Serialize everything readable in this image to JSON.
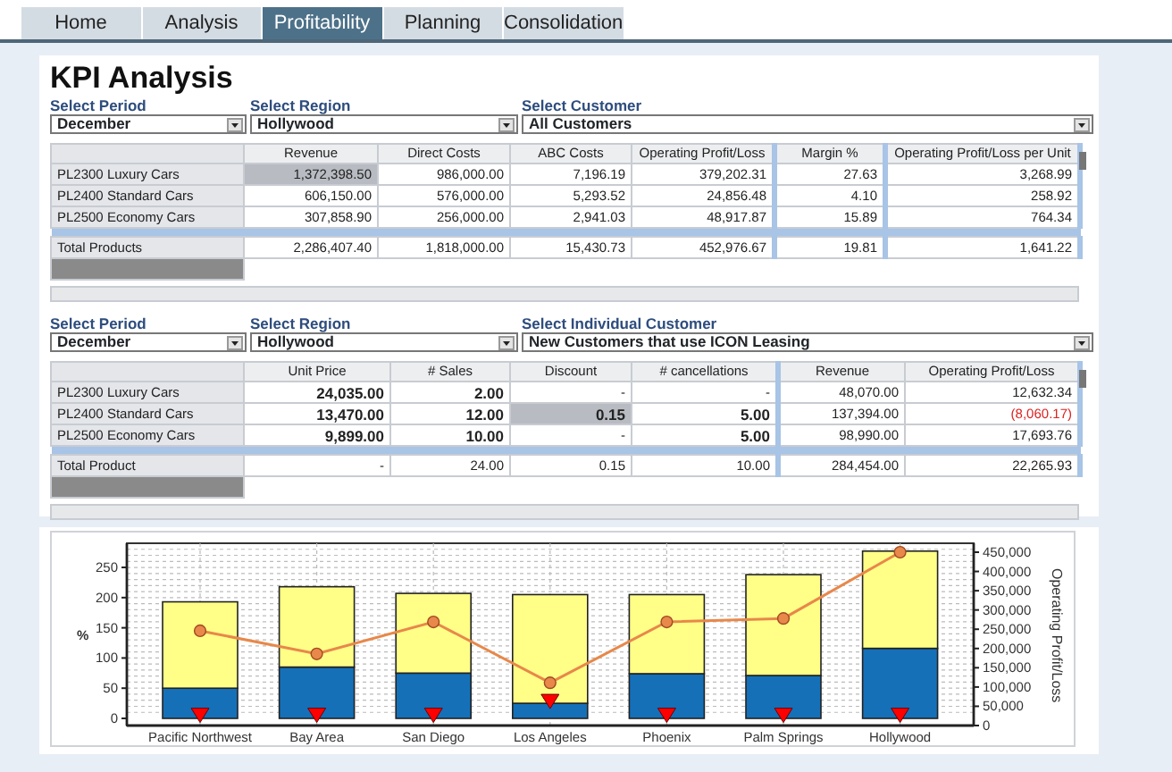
{
  "tabs": [
    {
      "label": "Home",
      "selected": false
    },
    {
      "label": "Analysis",
      "selected": false
    },
    {
      "label": "Profitability",
      "selected": true
    },
    {
      "label": "Planning",
      "selected": false
    },
    {
      "label": "Consolidation",
      "selected": false
    }
  ],
  "title": "KPI Analysis",
  "sections": [
    {
      "filters": [
        {
          "label": "Select Period",
          "value": "December"
        },
        {
          "label": "Select Region",
          "value": "Hollywood"
        },
        {
          "label": "Select Customer",
          "value": "All Customers"
        }
      ],
      "table": {
        "columns": [
          {
            "label": "Revenue",
            "group_start": false
          },
          {
            "label": "Direct Costs",
            "group_start": false
          },
          {
            "label": "ABC Costs",
            "group_start": false
          },
          {
            "label": "Operating Profit/Loss",
            "group_start": false
          },
          {
            "label": "Margin %",
            "group_start": true
          },
          {
            "label": "Operating Profit/Loss per Unit",
            "group_start": true
          }
        ],
        "rows": [
          {
            "label": "PL2300 Luxury Cars",
            "kind": "data",
            "cells": [
              {
                "text": "1,372,398.50",
                "selected": true,
                "bold": false,
                "negative": false
              },
              {
                "text": "986,000.00",
                "selected": false,
                "bold": false,
                "negative": false
              },
              {
                "text": "7,196.19",
                "selected": false,
                "bold": false,
                "negative": false
              },
              {
                "text": "379,202.31",
                "selected": false,
                "bold": false,
                "negative": false
              },
              {
                "text": "27.63",
                "selected": false,
                "bold": false,
                "negative": false
              },
              {
                "text": "3,268.99",
                "selected": false,
                "bold": false,
                "negative": false
              }
            ]
          },
          {
            "label": "PL2400 Standard Cars",
            "kind": "data",
            "cells": [
              {
                "text": "606,150.00",
                "selected": false,
                "bold": false,
                "negative": false
              },
              {
                "text": "576,000.00",
                "selected": false,
                "bold": false,
                "negative": false
              },
              {
                "text": "5,293.52",
                "selected": false,
                "bold": false,
                "negative": false
              },
              {
                "text": "24,856.48",
                "selected": false,
                "bold": false,
                "negative": false
              },
              {
                "text": "4.10",
                "selected": false,
                "bold": false,
                "negative": false
              },
              {
                "text": "258.92",
                "selected": false,
                "bold": false,
                "negative": false
              }
            ]
          },
          {
            "label": "PL2500 Economy Cars",
            "kind": "data",
            "cells": [
              {
                "text": "307,858.90",
                "selected": false,
                "bold": false,
                "negative": false
              },
              {
                "text": "256,000.00",
                "selected": false,
                "bold": false,
                "negative": false
              },
              {
                "text": "2,941.03",
                "selected": false,
                "bold": false,
                "negative": false
              },
              {
                "text": "48,917.87",
                "selected": false,
                "bold": false,
                "negative": false
              },
              {
                "text": "15.89",
                "selected": false,
                "bold": false,
                "negative": false
              },
              {
                "text": "764.34",
                "selected": false,
                "bold": false,
                "negative": false
              }
            ]
          },
          {
            "label": "Total Products",
            "kind": "total",
            "cells": [
              {
                "text": "2,286,407.40",
                "selected": false,
                "bold": false,
                "negative": false
              },
              {
                "text": "1,818,000.00",
                "selected": false,
                "bold": false,
                "negative": false
              },
              {
                "text": "15,430.73",
                "selected": false,
                "bold": false,
                "negative": false
              },
              {
                "text": "452,976.67",
                "selected": false,
                "bold": false,
                "negative": false
              },
              {
                "text": "19.81",
                "selected": false,
                "bold": false,
                "negative": false
              },
              {
                "text": "1,641.22",
                "selected": false,
                "bold": false,
                "negative": false
              }
            ]
          }
        ]
      }
    },
    {
      "filters": [
        {
          "label": "Select Period",
          "value": "December"
        },
        {
          "label": "Select Region",
          "value": "Hollywood"
        },
        {
          "label": "Select Individual Customer",
          "value": "New Customers that use ICON Leasing"
        }
      ],
      "table": {
        "columns": [
          {
            "label": "Unit Price",
            "group_start": false
          },
          {
            "label": "# Sales",
            "group_start": false
          },
          {
            "label": "Discount",
            "group_start": false
          },
          {
            "label": "# cancellations",
            "group_start": false
          },
          {
            "label": "Revenue",
            "group_start": true
          },
          {
            "label": "Operating Profit/Loss",
            "group_start": false
          }
        ],
        "rows": [
          {
            "label": "PL2300 Luxury Cars",
            "kind": "data",
            "cells": [
              {
                "text": "24,035.00",
                "selected": false,
                "bold": true,
                "negative": false
              },
              {
                "text": "2.00",
                "selected": false,
                "bold": true,
                "negative": false
              },
              {
                "text": "-",
                "selected": false,
                "bold": false,
                "negative": false
              },
              {
                "text": "-",
                "selected": false,
                "bold": false,
                "negative": false
              },
              {
                "text": "48,070.00",
                "selected": false,
                "bold": false,
                "negative": false
              },
              {
                "text": "12,632.34",
                "selected": false,
                "bold": false,
                "negative": false
              }
            ]
          },
          {
            "label": "PL2400 Standard Cars",
            "kind": "data",
            "cells": [
              {
                "text": "13,470.00",
                "selected": false,
                "bold": true,
                "negative": false
              },
              {
                "text": "12.00",
                "selected": false,
                "bold": true,
                "negative": false
              },
              {
                "text": "0.15",
                "selected": true,
                "bold": true,
                "negative": false
              },
              {
                "text": "5.00",
                "selected": false,
                "bold": true,
                "negative": false
              },
              {
                "text": "137,394.00",
                "selected": false,
                "bold": false,
                "negative": false
              },
              {
                "text": "(8,060.17)",
                "selected": false,
                "bold": false,
                "negative": true
              }
            ]
          },
          {
            "label": "PL2500 Economy Cars",
            "kind": "data",
            "cells": [
              {
                "text": "9,899.00",
                "selected": false,
                "bold": true,
                "negative": false
              },
              {
                "text": "10.00",
                "selected": false,
                "bold": true,
                "negative": false
              },
              {
                "text": "-",
                "selected": false,
                "bold": false,
                "negative": false
              },
              {
                "text": "5.00",
                "selected": false,
                "bold": true,
                "negative": false
              },
              {
                "text": "98,990.00",
                "selected": false,
                "bold": false,
                "negative": false
              },
              {
                "text": "17,693.76",
                "selected": false,
                "bold": false,
                "negative": false
              }
            ]
          },
          {
            "label": "Total Product",
            "kind": "total",
            "cells": [
              {
                "text": "-",
                "selected": false,
                "bold": false,
                "negative": false
              },
              {
                "text": "24.00",
                "selected": false,
                "bold": false,
                "negative": false
              },
              {
                "text": "0.15",
                "selected": false,
                "bold": false,
                "negative": false
              },
              {
                "text": "10.00",
                "selected": false,
                "bold": false,
                "negative": false
              },
              {
                "text": "284,454.00",
                "selected": false,
                "bold": false,
                "negative": false
              },
              {
                "text": "22,265.93",
                "selected": false,
                "bold": false,
                "negative": false
              }
            ]
          }
        ]
      }
    }
  ],
  "chart": {
    "chart_data": {
      "type": "bar",
      "stacked": true,
      "grid": true,
      "ylabel": "%",
      "y2label": "Operating Profit/Loss",
      "categories": [
        "Pacific Northwest",
        "Bay Area",
        "San Diego",
        "Los Angeles",
        "Phoenix",
        "Palm Springs",
        "Hollywood"
      ],
      "ylim": [
        0,
        290
      ],
      "yticks": [
        0,
        50,
        100,
        150,
        200,
        250
      ],
      "y2lim": [
        0,
        450000
      ],
      "y2ticks": [
        {
          "value": 0,
          "label": "0"
        },
        {
          "value": 50000,
          "label": "50,000"
        },
        {
          "value": 100000,
          "label": "100,000"
        },
        {
          "value": 150000,
          "label": "150,000"
        },
        {
          "value": 200000,
          "label": "200,000"
        },
        {
          "value": 250000,
          "label": "250,000"
        },
        {
          "value": 300000,
          "label": "300,000"
        },
        {
          "value": 350000,
          "label": "350,000"
        },
        {
          "value": 400000,
          "label": "400,000"
        },
        {
          "value": 450000,
          "label": "450,000"
        }
      ],
      "series": [
        {
          "type": "bar",
          "color": "#1570b8",
          "values": [
            50,
            85,
            75,
            25,
            74,
            71,
            116
          ]
        },
        {
          "type": "bar",
          "color": "#ffff88",
          "values": [
            143,
            133,
            132,
            180,
            131,
            167,
            161
          ]
        },
        {
          "type": "line",
          "axis": "y2",
          "marker": "circle",
          "color": "#e8884a",
          "values": [
            246000,
            186000,
            269000,
            111000,
            269000,
            278000,
            450000
          ]
        },
        {
          "type": "scatter",
          "marker": "triangle-down",
          "color": "#ff0000",
          "values": [
            5,
            5,
            5,
            28,
            5,
            5,
            5
          ]
        }
      ]
    }
  }
}
